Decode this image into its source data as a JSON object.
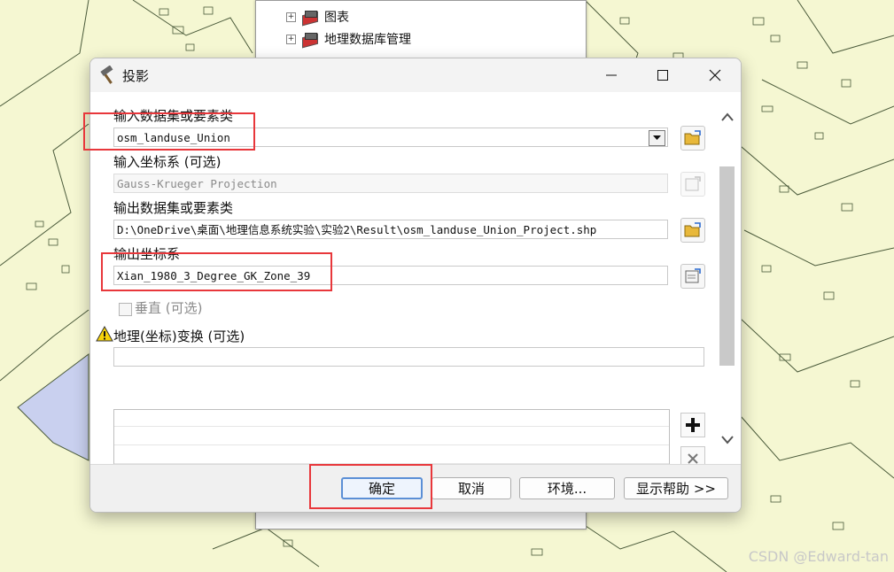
{
  "catalog": {
    "items": [
      {
        "label": "图表"
      },
      {
        "label": "地理数据库管理"
      }
    ]
  },
  "dialog": {
    "title": "投影",
    "input_dataset_label": "输入数据集或要素类",
    "input_dataset_value": "osm_landuse_Union",
    "input_cs_label": "输入坐标系 (可选)",
    "input_cs_value": "Gauss-Krueger Projection",
    "output_dataset_label": "输出数据集或要素类",
    "output_dataset_value": "D:\\OneDrive\\桌面\\地理信息系统实验\\实验2\\Result\\osm_landuse_Union_Project.shp",
    "output_cs_label": "输出坐标系",
    "output_cs_value": "Xian_1980_3_Degree_GK_Zone_39",
    "vertical_label": "垂直 (可选)",
    "geo_transform_label": "地理(坐标)变换 (可选)",
    "buttons": {
      "ok": "确定",
      "cancel": "取消",
      "environments": "环境...",
      "show_help": "显示帮助 >>"
    }
  },
  "watermark": "CSDN @Edward-tan"
}
